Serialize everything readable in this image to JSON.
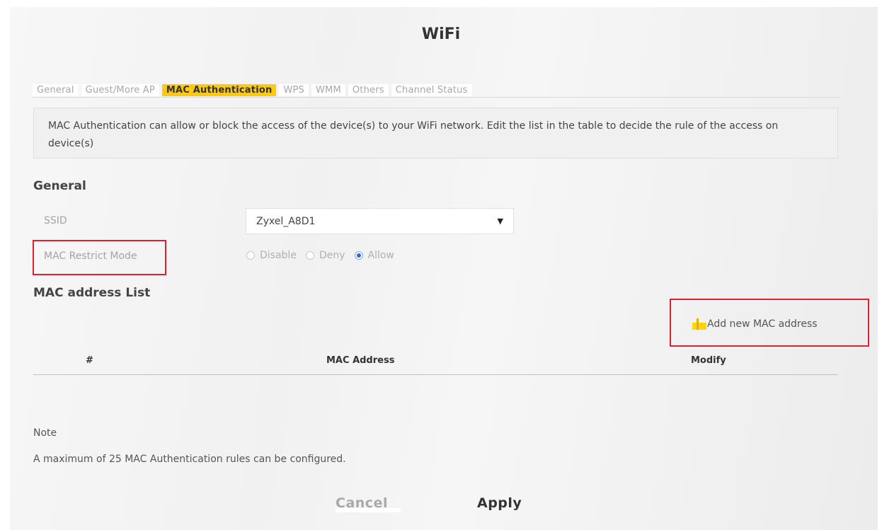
{
  "page": {
    "title": "WiFi"
  },
  "tabs": [
    {
      "label": "General",
      "active": false
    },
    {
      "label": "Guest/More AP",
      "active": false
    },
    {
      "label": "MAC Authentication",
      "active": true
    },
    {
      "label": "WPS",
      "active": false
    },
    {
      "label": "WMM",
      "active": false
    },
    {
      "label": "Others",
      "active": false
    },
    {
      "label": "Channel Status",
      "active": false
    }
  ],
  "description": "MAC Authentication can allow or block the access of the device(s) to your WiFi network. Edit the list in the table to decide the rule of the access on device(s)",
  "general": {
    "title": "General",
    "ssid_label": "SSID",
    "ssid_value": "Zyxel_A8D1",
    "mode_label": "MAC Restrict Mode",
    "mode_options": [
      "Disable",
      "Deny",
      "Allow"
    ],
    "mode_selected": "Allow"
  },
  "mac_list": {
    "title": "MAC address List",
    "add_label": "Add new MAC address",
    "columns": [
      "#",
      "MAC Address",
      "Modify"
    ],
    "rows": []
  },
  "note": {
    "title": "Note",
    "text": "A maximum of 25 MAC Authentication rules can be configured."
  },
  "buttons": {
    "cancel": "Cancel",
    "apply": "Apply"
  },
  "colors": {
    "accent": "#ffc90e",
    "highlight_box": "#e0202c",
    "radio_selected": "#2b6ad3"
  },
  "icons": {
    "dropdown": "chevron-down-icon",
    "add": "plus-icon"
  }
}
